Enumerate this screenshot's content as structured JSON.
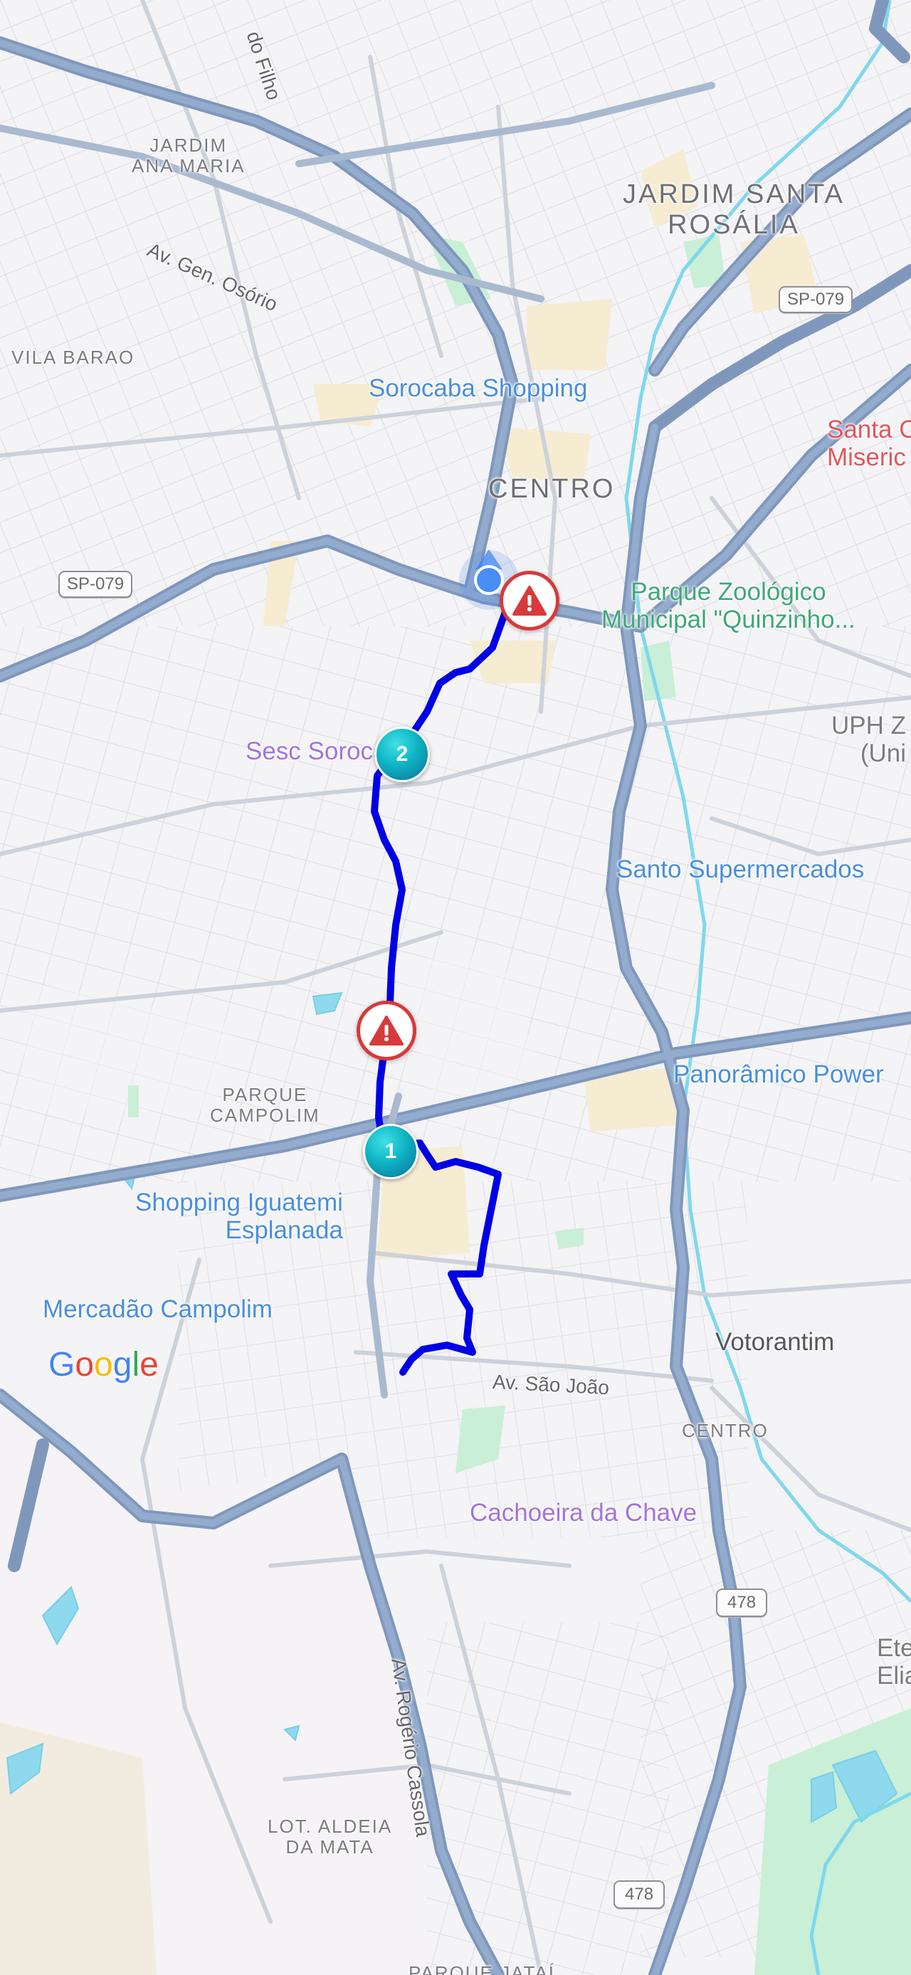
{
  "map": {
    "areas": {
      "jardim_ana_maria": "JARDIM\nANA MARIA",
      "jardim_santa_rosalia": "JARDIM SANTA\nROSÁLIA",
      "vila_barao": "VILA BARAO",
      "centro": "CENTRO",
      "parque_campolim": "PARQUE\nCAMPOLIM",
      "centro_votorantim": "CENTRO",
      "lot_aldeia_da_mata": "LOT. ALDEIA\nDA MATA",
      "parque_jatai": "PARQUE JATAÍ"
    },
    "cities": {
      "votorantim": "Votorantim"
    },
    "roads": {
      "do_filho": "do Filho",
      "gen_osorio": "Av. Gen. Osório",
      "sao_joao": "Av. São João",
      "rogerio_cassola": "Av. Rogério Cassola"
    },
    "shields": {
      "sp079_a": "SP-079",
      "sp079_b": "SP-079",
      "r478_a": "478",
      "r478_b": "478"
    },
    "pois": {
      "sorocaba_shopping": "Sorocaba Shopping",
      "santa_casa": "Santa C\nMiseric",
      "parque_zoologico": "Parque Zoológico\nMunicipal \"Quinzinho...",
      "sesc_sorocaba": "Sesc Sorocaba",
      "uph": "UPH Z\n(Uni",
      "santo_supermercados": "Santo Supermercados",
      "panoramico_power": "Panorâmico Power",
      "shopping_iguatemi": "Shopping Iguatemi\nEsplanada",
      "mercadao_campolim": "Mercadão Campolim",
      "cachoeira_da_chave": "Cachoeira da Chave",
      "ete_elias": "Ete\nElia"
    },
    "waypoints": {
      "wp1": "1",
      "wp2": "2"
    },
    "google": [
      "G",
      "o",
      "o",
      "g",
      "l",
      "e"
    ],
    "colors": {
      "route": "#0000e6",
      "major_road": "#8aa2c4",
      "minor_road": "#cdd1d9",
      "water": "#7fd8ec",
      "park": "#c9efd6",
      "alert": "#d73a3a",
      "location": "#3b82f6"
    }
  }
}
